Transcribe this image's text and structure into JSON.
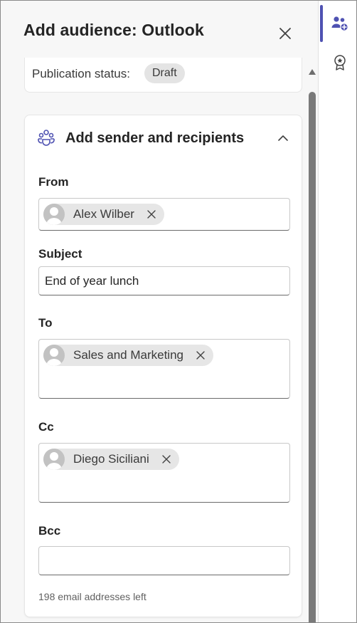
{
  "header": {
    "title": "Add audience: Outlook"
  },
  "status": {
    "label": "Publication status:",
    "value": "Draft"
  },
  "section": {
    "title": "Add sender and recipients",
    "expanded": true
  },
  "fields": {
    "from": {
      "label": "From",
      "recipients": [
        "Alex Wilber"
      ]
    },
    "subject": {
      "label": "Subject",
      "value": "End of year lunch"
    },
    "to": {
      "label": "To",
      "recipients": [
        "Sales and Marketing"
      ]
    },
    "cc": {
      "label": "Cc",
      "recipients": [
        "Diego Siciliani"
      ]
    },
    "bcc": {
      "label": "Bcc",
      "value": ""
    }
  },
  "footnote": "198 email addresses left",
  "rail": {
    "items": [
      {
        "icon": "people-add-icon",
        "active": true
      },
      {
        "icon": "ribbon-star-icon",
        "active": false
      }
    ]
  },
  "colors": {
    "accent": "#4f52b2",
    "chip_bg": "#e6e6e6",
    "panel_bg": "#f7f7f7"
  }
}
